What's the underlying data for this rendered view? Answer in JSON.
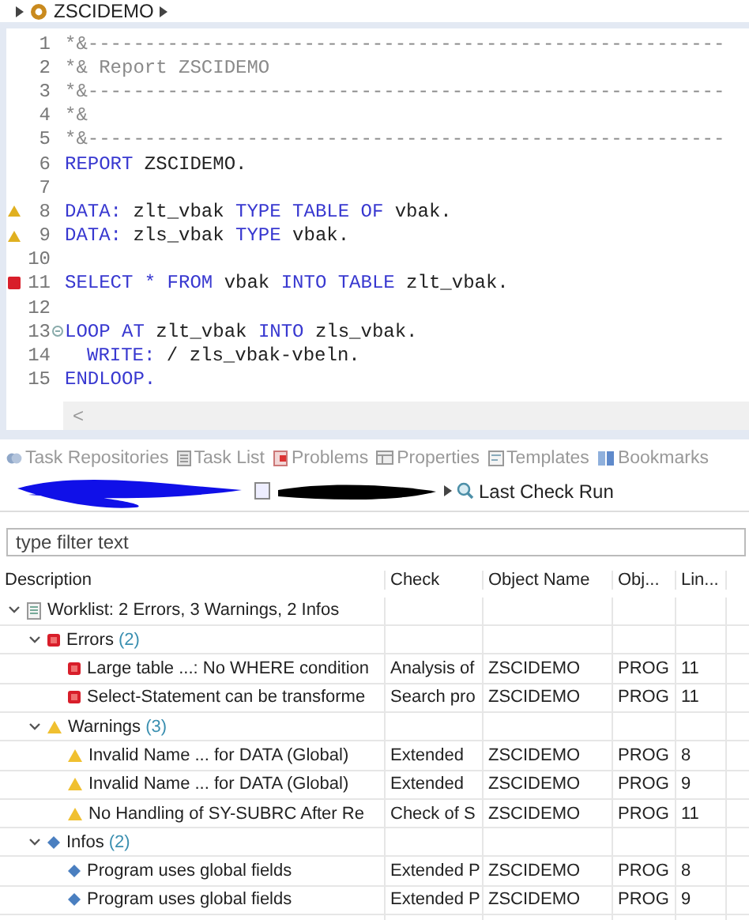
{
  "breadcrumb": {
    "title": "ZSCIDEMO"
  },
  "editor": {
    "lines": [
      {
        "number": "1",
        "tokens": [
          {
            "kind": "comment",
            "text": "*&--------------------------------------------------------"
          }
        ]
      },
      {
        "number": "2",
        "tokens": [
          {
            "kind": "comment",
            "text": "*& Report ZSCIDEMO"
          }
        ]
      },
      {
        "number": "3",
        "tokens": [
          {
            "kind": "comment",
            "text": "*&--------------------------------------------------------"
          }
        ]
      },
      {
        "number": "4",
        "tokens": [
          {
            "kind": "comment",
            "text": "*&"
          }
        ]
      },
      {
        "number": "5",
        "tokens": [
          {
            "kind": "comment",
            "text": "*&--------------------------------------------------------"
          }
        ]
      },
      {
        "number": "6",
        "tokens": [
          {
            "kind": "keyword",
            "text": "REPORT"
          },
          {
            "kind": "plain",
            "text": " ZSCIDEMO."
          }
        ]
      },
      {
        "number": "7"
      },
      {
        "number": "8",
        "kind": "warning",
        "tokens": [
          {
            "kind": "keyword",
            "text": "DATA:"
          },
          {
            "kind": "plain",
            "text": " zlt_vbak "
          },
          {
            "kind": "keyword",
            "text": "TYPE TABLE OF"
          },
          {
            "kind": "plain",
            "text": " vbak."
          }
        ]
      },
      {
        "number": "9",
        "kind": "warning",
        "tokens": [
          {
            "kind": "keyword",
            "text": "DATA:"
          },
          {
            "kind": "plain",
            "text": " zls_vbak "
          },
          {
            "kind": "keyword",
            "text": "TYPE"
          },
          {
            "kind": "plain",
            "text": " vbak."
          }
        ]
      },
      {
        "number": "10"
      },
      {
        "number": "11",
        "kind": "error",
        "tokens": [
          {
            "kind": "keyword",
            "text": "SELECT * FROM"
          },
          {
            "kind": "plain",
            "text": " vbak "
          },
          {
            "kind": "keyword",
            "text": "INTO TABLE"
          },
          {
            "kind": "plain",
            "text": " zlt_vbak."
          }
        ]
      },
      {
        "number": "12"
      },
      {
        "number": "13",
        "kind": "fold",
        "tokens": [
          {
            "kind": "keyword",
            "text": "LOOP AT"
          },
          {
            "kind": "plain",
            "text": " zlt_vbak "
          },
          {
            "kind": "keyword",
            "text": "INTO"
          },
          {
            "kind": "plain",
            "text": " zls_vbak."
          }
        ]
      },
      {
        "number": "14",
        "indented": true,
        "tokens": [
          {
            "kind": "keyword",
            "text": "WRITE:"
          },
          {
            "kind": "plain",
            "text": " / zls_vbak-vbeln."
          }
        ]
      },
      {
        "number": "15",
        "tokens": [
          {
            "kind": "keyword",
            "text": "ENDLOOP."
          }
        ]
      }
    ],
    "scroll_left": "<"
  },
  "view_tabs": [
    "Task Repositories",
    "Task List",
    "Problems",
    "Properties",
    "Templates",
    "Bookmarks"
  ],
  "toolbar": {
    "last_run": "Last Check Run"
  },
  "filter": {
    "placeholder": "type filter text"
  },
  "table": {
    "columns": [
      "Description",
      "Check",
      "Object Name",
      "Obj...",
      "Lin..."
    ],
    "rows": [
      {
        "kind": "worklist",
        "expanded": true,
        "label": "Worklist: 2 Errors, 3 Warnings, 2 Infos",
        "children": [
          {
            "kind": "error",
            "expanded": true,
            "label": "Errors",
            "count": "(2)",
            "children": [
              {
                "kind": "error",
                "label": "Large table ...: No WHERE condition",
                "cells": [
                  "Analysis of",
                  "ZSCIDEMO",
                  "PROG",
                  "11"
                ]
              },
              {
                "kind": "error",
                "label": "Select-Statement can be transforme",
                "cells": [
                  "Search pro",
                  "ZSCIDEMO",
                  "PROG",
                  "11"
                ]
              }
            ]
          },
          {
            "kind": "warning",
            "expanded": true,
            "label": "Warnings",
            "count": "(3)",
            "children": [
              {
                "kind": "warning",
                "label": "Invalid Name ... for DATA (Global)",
                "cells": [
                  "Extended",
                  "ZSCIDEMO",
                  "PROG",
                  "8"
                ]
              },
              {
                "kind": "warning",
                "label": "Invalid Name ... for DATA (Global)",
                "cells": [
                  "Extended",
                  "ZSCIDEMO",
                  "PROG",
                  "9"
                ]
              },
              {
                "kind": "warning",
                "label": "No Handling of SY-SUBRC After Re",
                "cells": [
                  "Check of S",
                  "ZSCIDEMO",
                  "PROG",
                  "11"
                ]
              }
            ]
          },
          {
            "kind": "info",
            "expanded": true,
            "label": "Infos",
            "count": "(2)",
            "children": [
              {
                "kind": "info",
                "label": "Program uses global fields",
                "cells": [
                  "Extended P",
                  "ZSCIDEMO",
                  "PROG",
                  "8"
                ]
              },
              {
                "kind": "info",
                "label": "Program uses global fields",
                "cells": [
                  "Extended P",
                  "ZSCIDEMO",
                  "PROG",
                  "9"
                ]
              }
            ]
          }
        ]
      }
    ]
  }
}
